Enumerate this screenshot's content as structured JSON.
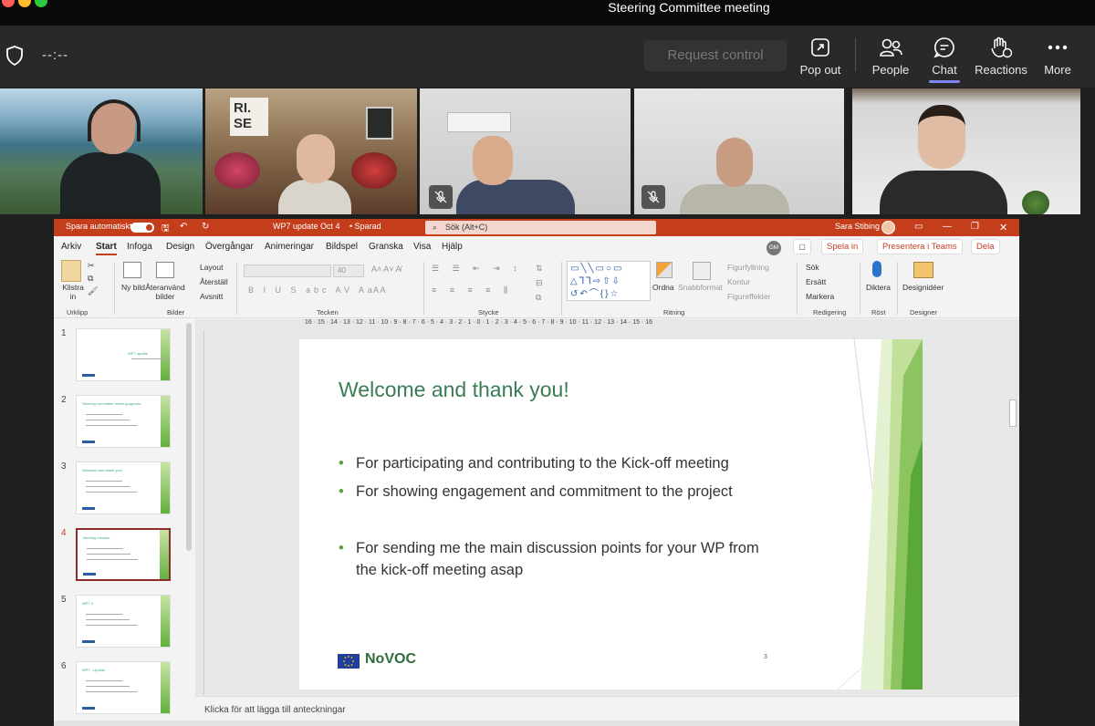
{
  "window": {
    "title": "Steering Committee meeting"
  },
  "toolbar": {
    "timer": "--:--",
    "request_control": "Request control",
    "buttons": [
      {
        "label": "Pop out",
        "icon": "pop-out-icon"
      },
      {
        "label": "People",
        "icon": "people-icon"
      },
      {
        "label": "Chat",
        "icon": "chat-icon"
      },
      {
        "label": "Reactions",
        "icon": "reactions-icon"
      },
      {
        "label": "More",
        "icon": "more-icon"
      }
    ],
    "active": "Chat",
    "accent": "#7f85f5"
  },
  "participants": [
    {
      "muted": false
    },
    {
      "muted": false,
      "wall_sign": "RI. SE"
    },
    {
      "muted": true
    },
    {
      "muted": true
    },
    {
      "muted": false
    }
  ],
  "powerpoint": {
    "autosave": "Spara automatiskt",
    "doc_title": "WP7 update Oct 4",
    "save_state": "• Sparad",
    "search_placeholder": "Sök (Alt+C)",
    "user": "Sara Stibing",
    "user_initials": "GM",
    "brand_color": "#c43e1c",
    "menu": [
      "Arkiv",
      "Start",
      "Infoga",
      "Design",
      "Övergångar",
      "Animeringar",
      "Bildspel",
      "Granska",
      "Visa",
      "Hjälp"
    ],
    "menu_active": "Start",
    "actions": {
      "present": "Spela in",
      "present_teams": "Presentera i Teams",
      "share": "Dela"
    },
    "ribbon": {
      "clipboard": {
        "paste": "Klistra in",
        "group": "Urklipp"
      },
      "slides": {
        "new": "Ny bild",
        "reuse": "Återanvänd bilder",
        "layout": "Layout",
        "reset": "Återställ",
        "section": "Avsnitt",
        "group": "Bilder"
      },
      "font": {
        "size": "40",
        "group": "Tecken"
      },
      "paragraph": {
        "group": "Stycke"
      },
      "drawing": {
        "arrange": "Ordna",
        "quick_styles": "Snabbformat",
        "fill": "Figurfyllning",
        "outline": "Kontur",
        "effects": "Figureffekter",
        "group": "Ritning"
      },
      "editing": {
        "find": "Sök",
        "replace": "Ersätt",
        "select": "Markera",
        "group": "Redigering"
      },
      "voice": {
        "dictate": "Diktera",
        "group": "Röst"
      },
      "designer": {
        "ideas": "Designidéer",
        "group": "Designer"
      }
    },
    "thumbnails": [
      {
        "num": "1",
        "text": "WP7 update"
      },
      {
        "num": "2",
        "text": "Steering committee meeting agenda"
      },
      {
        "num": "3",
        "text": "Welcome and thank you!"
      },
      {
        "num": "4",
        "text": "Meeting minutes",
        "selected": true
      },
      {
        "num": "5",
        "text": "WP7.3"
      },
      {
        "num": "6",
        "text": "WP7 - Update"
      }
    ],
    "slide": {
      "title": "Welcome and thank you!",
      "bullets": [
        "For participating and contributing to the Kick-off meeting",
        "For showing engagement and commitment to the project",
        "For sending me the main discussion points for your WP from",
        "the kick-off meeting asap"
      ],
      "logo_text": "NoVOC",
      "page": "3"
    },
    "notes_placeholder": "Klicka för att lägga till anteckningar",
    "ruler": "16 · 15 · 14 · 13 · 12 · 11 · 10 · 9 · 8 · 7 · 6 · 5 · 4 · 3 · 2 · 1 · 0 · 1 · 2 · 3 · 4 · 5 · 6 · 7 · 8 · 9 · 10 · 11 · 12 · 13 · 14 · 15 · 16"
  }
}
